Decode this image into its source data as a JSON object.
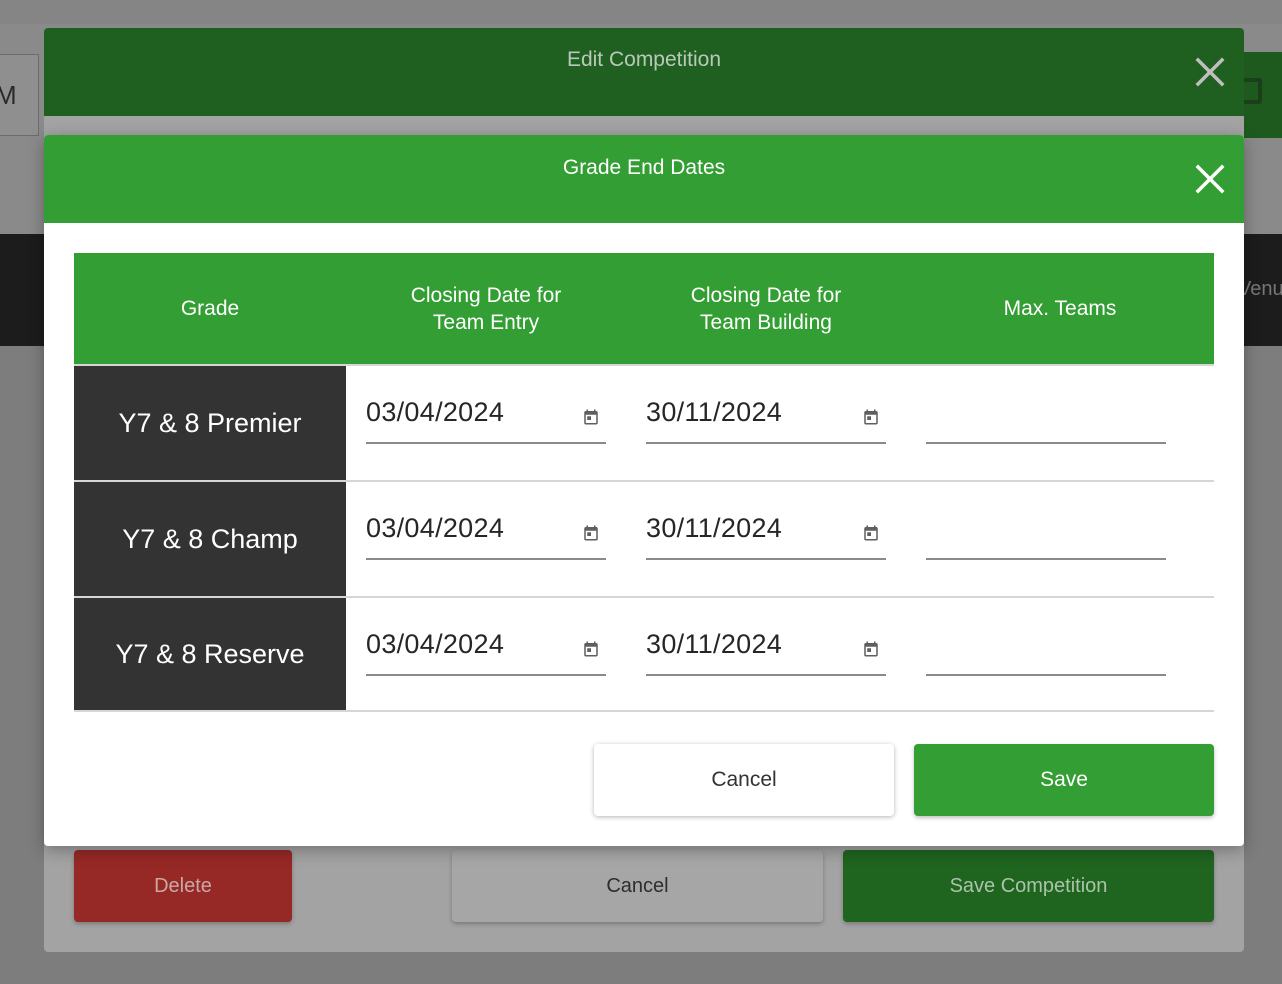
{
  "background": {
    "input_fragment": "M",
    "venue_fragment": "Venu"
  },
  "outer_modal": {
    "title": "Edit Competition",
    "buttons": {
      "delete": "Delete",
      "cancel": "Cancel",
      "save": "Save Competition"
    }
  },
  "inner_modal": {
    "title": "Grade End Dates",
    "columns": {
      "grade": "Grade",
      "team_entry": "Closing Date for Team Entry",
      "team_building": "Closing Date for Team Building",
      "max_teams": "Max. Teams"
    },
    "rows": [
      {
        "grade": "Y7 & 8 Premier",
        "team_entry": "03/04/2024",
        "team_building": "30/11/2024",
        "max_teams": ""
      },
      {
        "grade": "Y7 & 8 Champ",
        "team_entry": "03/04/2024",
        "team_building": "30/11/2024",
        "max_teams": ""
      },
      {
        "grade": "Y7 & 8 Reserve",
        "team_entry": "03/04/2024",
        "team_building": "30/11/2024",
        "max_teams": ""
      }
    ],
    "buttons": {
      "cancel": "Cancel",
      "save": "Save"
    }
  },
  "colors": {
    "header_green": "#339e33",
    "grade_cell_dark": "#333333",
    "delete_red": "#962825"
  },
  "icons": {
    "close": "close-icon",
    "date_picker": "calendar-icon"
  }
}
